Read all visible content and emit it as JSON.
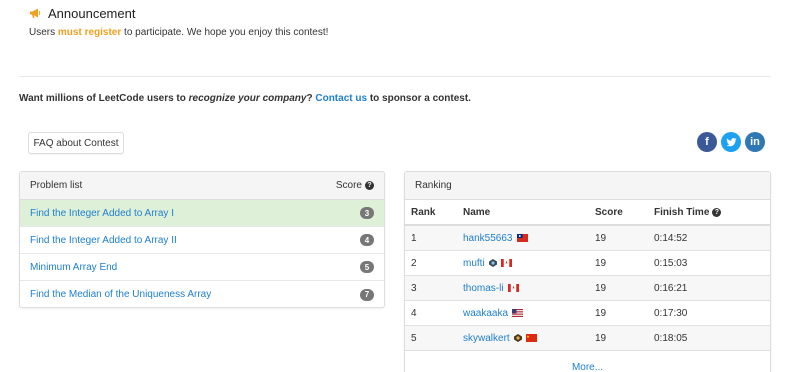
{
  "announcement": {
    "title": "Announcement",
    "text_before": "Users",
    "link": "must register",
    "text_after": "to participate. We hope you enjoy this contest!"
  },
  "sponsor": {
    "part1": "Want millions of LeetCode users to",
    "emphasis": "recognize your company",
    "part2": "?",
    "link": "Contact us",
    "part3": "to sponsor a contest."
  },
  "faq_button": "FAQ about Contest",
  "social": {
    "facebook": "f",
    "twitter": "t",
    "linkedin": "in"
  },
  "problem_list": {
    "header": "Problem list",
    "score_header": "Score",
    "items": [
      {
        "name": "Find the Integer Added to Array I",
        "score": "3"
      },
      {
        "name": "Find the Integer Added to Array II",
        "score": "4"
      },
      {
        "name": "Minimum Array End",
        "score": "5"
      },
      {
        "name": "Find the Median of the Uniqueness Array",
        "score": "7"
      }
    ]
  },
  "ranking": {
    "header": "Ranking",
    "columns": {
      "rank": "Rank",
      "name": "Name",
      "score": "Score",
      "finish_time": "Finish Time"
    },
    "rows": [
      {
        "rank": "1",
        "name": "hank55663",
        "flag": "taiwan",
        "score": "19",
        "time": "0:14:52"
      },
      {
        "rank": "2",
        "name": "mufti",
        "flag": "canada",
        "score": "19",
        "time": "0:15:03"
      },
      {
        "rank": "3",
        "name": "thomas-li",
        "flag": "canada",
        "score": "19",
        "time": "0:16:21"
      },
      {
        "rank": "4",
        "name": "waakaaka",
        "flag": "usa",
        "score": "19",
        "time": "0:17:30"
      },
      {
        "rank": "5",
        "name": "skywalkert",
        "flag": "china",
        "score": "19",
        "time": "0:18:05"
      }
    ],
    "more": "More..."
  },
  "colors": {
    "link": "#1e7fcf",
    "accent": "#f0a020",
    "highlight": "#dff0d8"
  }
}
